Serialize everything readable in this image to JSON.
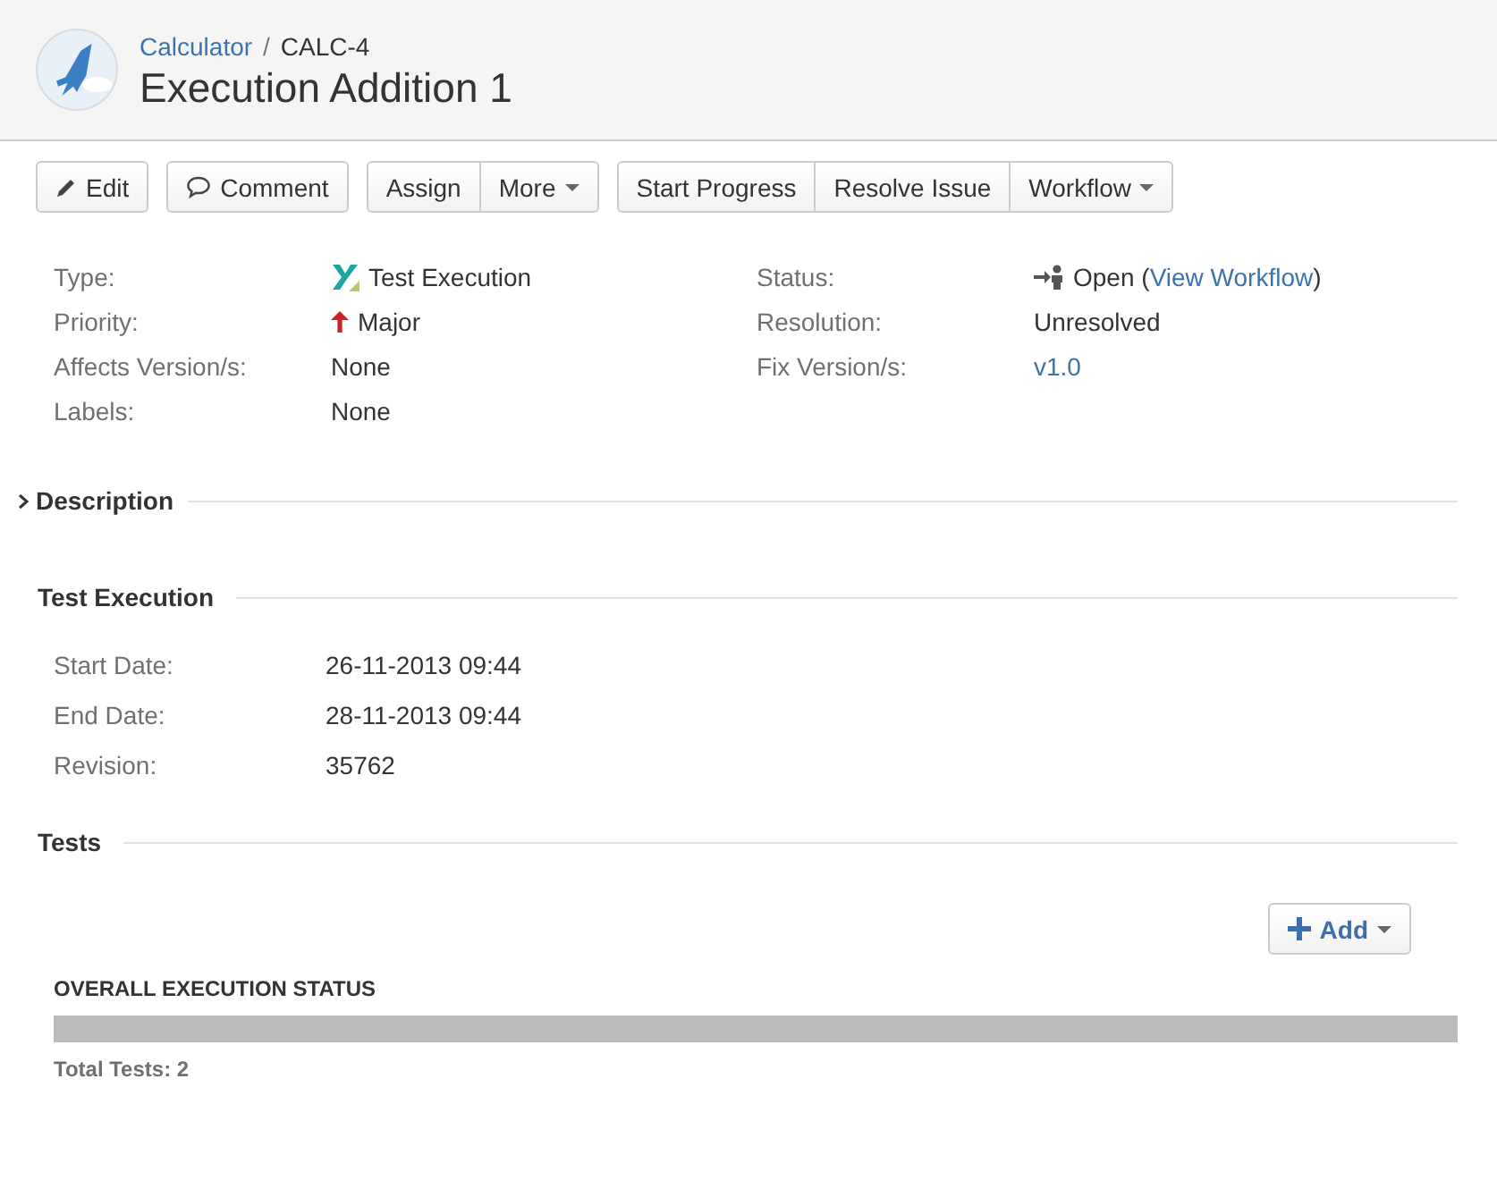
{
  "header": {
    "breadcrumb": {
      "project": "Calculator",
      "separator": "/",
      "key": "CALC-4"
    },
    "title": "Execution Addition 1"
  },
  "toolbar": [
    [
      {
        "label": "Edit",
        "kind": "edit"
      }
    ],
    [
      {
        "label": "Comment",
        "kind": "comment"
      }
    ],
    [
      {
        "label": "Assign",
        "kind": "plain"
      },
      {
        "label": "More",
        "kind": "dropdown"
      }
    ],
    [
      {
        "label": "Start Progress",
        "kind": "plain"
      },
      {
        "label": "Resolve Issue",
        "kind": "plain"
      },
      {
        "label": "Workflow",
        "kind": "dropdown"
      }
    ]
  ],
  "details": {
    "left": [
      {
        "label": "Type:",
        "value": "Test Execution",
        "kind": "type"
      },
      {
        "label": "Priority:",
        "value": "Major",
        "kind": "priority"
      },
      {
        "label": "Affects Version/s:",
        "value": "None",
        "kind": "text"
      },
      {
        "label": "Labels:",
        "value": "None",
        "kind": "text"
      }
    ],
    "right": [
      {
        "label": "Status:",
        "value": "Open (",
        "link": "View Workflow",
        "after": ")",
        "kind": "status"
      },
      {
        "label": "Resolution:",
        "value": "Unresolved",
        "kind": "text"
      },
      {
        "label": "Fix Version/s:",
        "value": "v1.0",
        "kind": "link"
      }
    ]
  },
  "description": {
    "title": "Description",
    "expanded": false
  },
  "test_execution": {
    "title": "Test Execution",
    "fields": [
      {
        "label": "Start Date:",
        "value": "26-11-2013 09:44"
      },
      {
        "label": "End Date:",
        "value": "28-11-2013 09:44"
      },
      {
        "label": "Revision:",
        "value": "35762"
      }
    ]
  },
  "tests": {
    "title": "Tests",
    "add_button": "Add",
    "status_label": "OVERALL EXECUTION STATUS",
    "total": "Total Tests: 2"
  }
}
